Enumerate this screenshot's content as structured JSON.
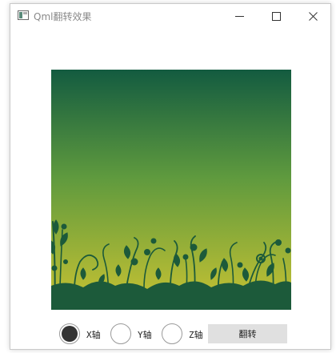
{
  "window": {
    "title": "Qml翻转效果"
  },
  "image": {
    "gradient_top": "#135b40",
    "gradient_bottom": "#c9c332",
    "foliage_color": "#1c5a3a"
  },
  "controls": {
    "axes": [
      {
        "label": "X轴",
        "checked": true
      },
      {
        "label": "Y轴",
        "checked": false
      },
      {
        "label": "Z轴",
        "checked": false
      }
    ],
    "flip_label": "翻转"
  }
}
